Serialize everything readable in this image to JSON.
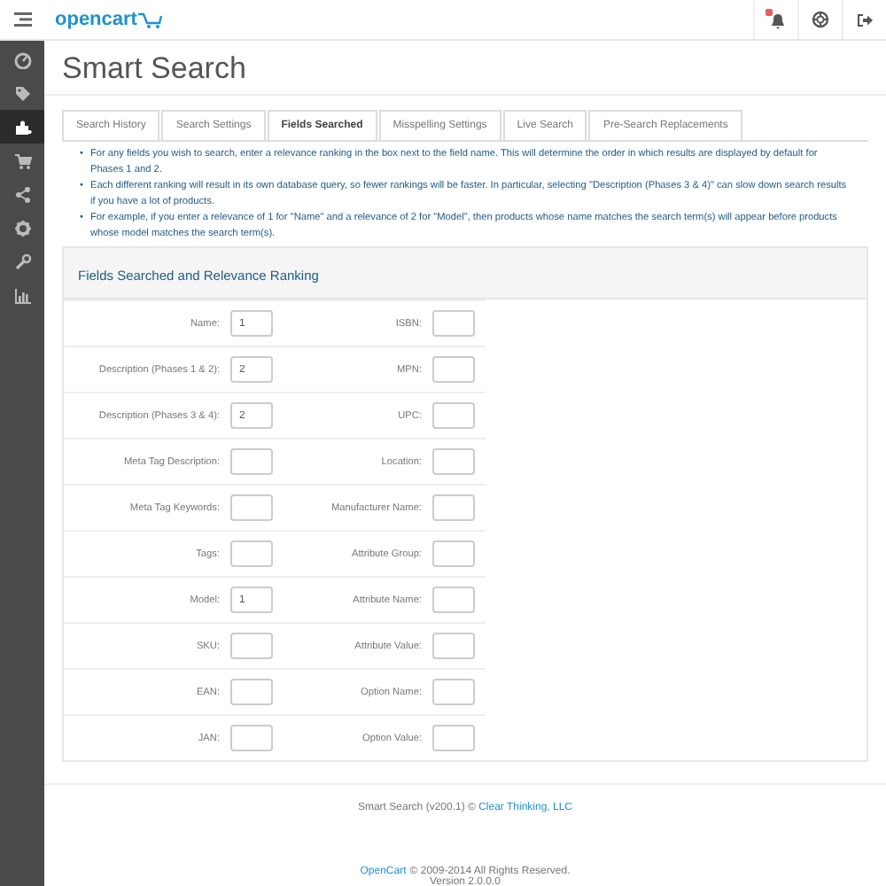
{
  "header": {
    "logo": "opencart",
    "notifications": {
      "has_alert": true
    }
  },
  "sidebar": {
    "items": [
      {
        "selected": false
      },
      {
        "selected": false
      },
      {
        "selected": true
      },
      {
        "selected": false
      },
      {
        "selected": false
      },
      {
        "selected": false
      },
      {
        "selected": false
      },
      {
        "selected": false
      }
    ]
  },
  "page_title": "Smart Search",
  "tabs": [
    {
      "label": "Search History",
      "selected": false
    },
    {
      "label": "Search Settings",
      "selected": false
    },
    {
      "label": "Fields Searched",
      "selected": true
    },
    {
      "label": "Misspelling Settings",
      "selected": false
    },
    {
      "label": "Live Search",
      "selected": false
    },
    {
      "label": "Pre-Search Replacements",
      "selected": false
    }
  ],
  "note_marker": "•",
  "notes": [
    "For any fields you wish to search, enter a relevance ranking in the box next to the field name. This will determine the order in which results are displayed by default for Phases 1 and 2.",
    "Each different ranking will result in its own database query, so fewer rankings will be faster. In particular, selecting \"Description (Phases 3 & 4)\" can slow down search results if you have a lot of products.",
    "For example, if you enter a relevance of 1 for \"Name\" and a relevance of 2 for \"Model\", then products whose name matches the search term(s) will appear before products whose model matches the search term(s)."
  ],
  "panel": {
    "title": "Fields Searched and Relevance Ranking",
    "rows": [
      {
        "left": {
          "label": "Name:",
          "value": "1"
        },
        "right": {
          "label": "ISBN:"
        }
      },
      {
        "left": {
          "label": "Description (Phases 1 & 2):",
          "value": "2"
        },
        "right": {
          "label": "MPN:"
        }
      },
      {
        "left": {
          "label": "Description (Phases 3 & 4):",
          "value": "2"
        },
        "right": {
          "label": "UPC:"
        }
      },
      {
        "left": {
          "label": "Meta Tag Description:"
        },
        "right": {
          "label": "Location:"
        }
      },
      {
        "left": {
          "label": "Meta Tag Keywords:"
        },
        "right": {
          "label": "Manufacturer Name:"
        }
      },
      {
        "left": {
          "label": "Tags:"
        },
        "right": {
          "label": "Attribute Group:"
        }
      },
      {
        "left": {
          "label": "Model:",
          "value": "1"
        },
        "right": {
          "label": "Attribute Name:"
        }
      },
      {
        "left": {
          "label": "SKU:"
        },
        "right": {
          "label": "Attribute Value:"
        }
      },
      {
        "left": {
          "label": "EAN:"
        },
        "right": {
          "label": "Option Name:"
        }
      },
      {
        "left": {
          "label": "JAN:"
        },
        "right": {
          "label": "Option Value:"
        }
      }
    ]
  },
  "extension_footer": {
    "text": "Smart Search (v200.1) ©",
    "link": "Clear Thinking, LLC"
  },
  "footer": {
    "link": "OpenCart",
    "text": "© 2009-2014 All Rights Reserved.",
    "version": "Version 2.0.0.0"
  }
}
